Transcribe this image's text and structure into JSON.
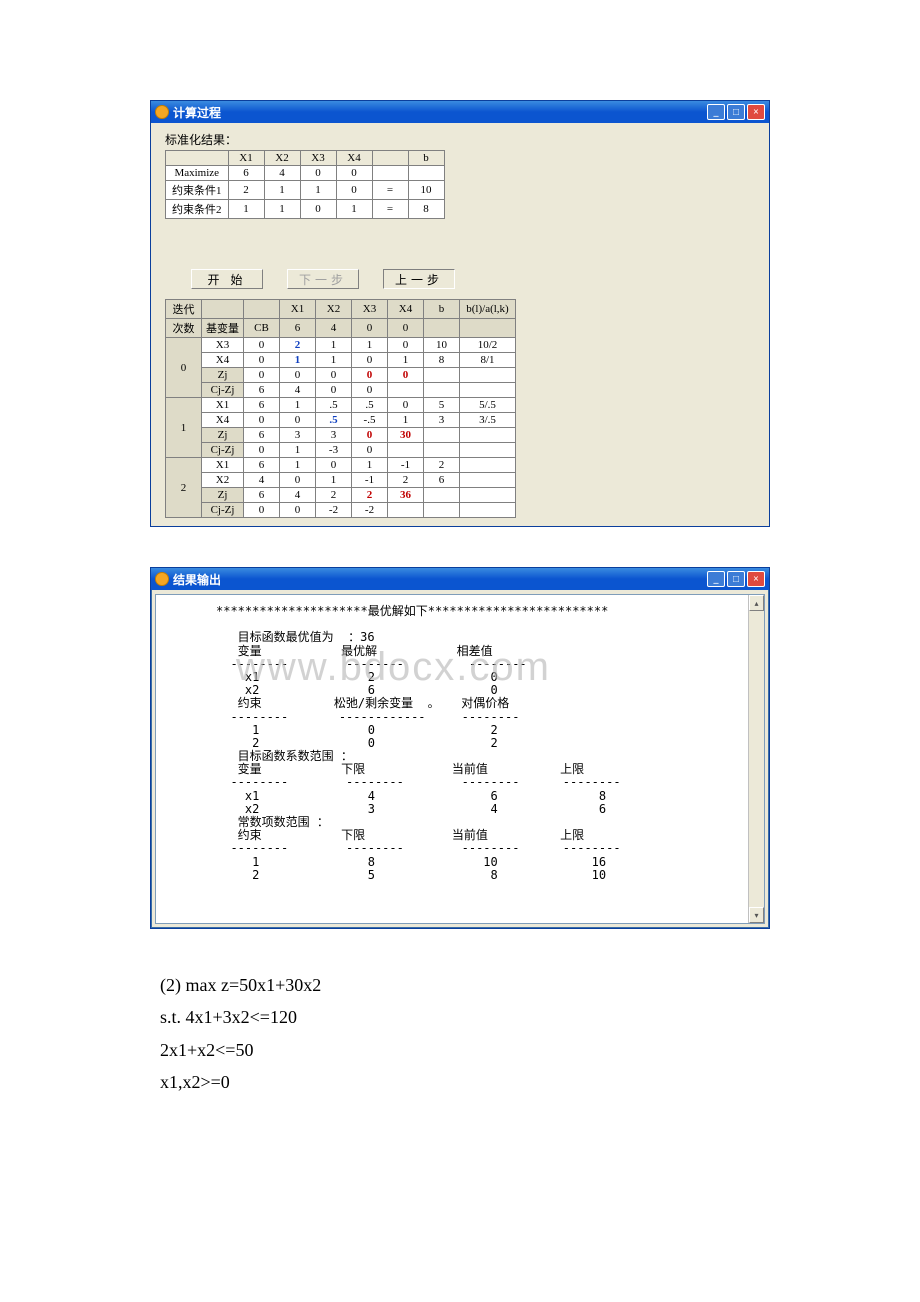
{
  "win1": {
    "title": "计算过程",
    "sectionLabel": "标准化结果：",
    "std": {
      "headers": [
        "",
        "X1",
        "X2",
        "X3",
        "X4",
        "",
        "b"
      ],
      "rows": [
        [
          "Maximize",
          "6",
          "4",
          "0",
          "0",
          "",
          ""
        ],
        [
          "约束条件1",
          "2",
          "1",
          "1",
          "0",
          "=",
          "10"
        ],
        [
          "约束条件2",
          "1",
          "1",
          "0",
          "1",
          "=",
          "8"
        ]
      ]
    },
    "buttons": {
      "start": "开 始",
      "next": "下一步",
      "prev": "上一步"
    },
    "simplex": {
      "topHeaders": [
        "迭代",
        "",
        "",
        "X1",
        "X2",
        "X3",
        "X4",
        "b",
        "b(l)/a(l,k)"
      ],
      "subHeaders": [
        "次数",
        "基变量",
        "CB",
        "6",
        "4",
        "0",
        "0",
        "",
        ""
      ],
      "iters": [
        {
          "num": "0",
          "rows": [
            [
              "X3",
              "0",
              "2",
              "1",
              "1",
              "0",
              "10",
              "10/2"
            ],
            [
              "X4",
              "0",
              "1",
              "1",
              "0",
              "1",
              "8",
              "8/1"
            ],
            [
              "Zj",
              "0",
              "0",
              "0",
              "0",
              "_0_",
              ""
            ],
            [
              "Cj-Zj",
              "6",
              "4",
              "0",
              "0",
              "",
              ""
            ]
          ],
          "blueCells": [
            [
              0,
              2
            ],
            [
              1,
              2
            ]
          ],
          "redCells": [
            [
              2,
              4
            ]
          ]
        },
        {
          "num": "1",
          "rows": [
            [
              "X1",
              "6",
              "1",
              ".5",
              ".5",
              "0",
              "5",
              "5/.5"
            ],
            [
              "X4",
              "0",
              "0",
              ".5",
              "-.5",
              "1",
              "3",
              "3/.5"
            ],
            [
              "Zj",
              "6",
              "3",
              "3",
              "0",
              "_30_",
              ""
            ],
            [
              "Cj-Zj",
              "0",
              "1",
              "-3",
              "0",
              "",
              ""
            ]
          ],
          "blueCells": [
            [
              1,
              3
            ]
          ],
          "redCells": [
            [
              2,
              4
            ]
          ]
        },
        {
          "num": "2",
          "rows": [
            [
              "X1",
              "6",
              "1",
              "0",
              "1",
              "-1",
              "2",
              ""
            ],
            [
              "X2",
              "4",
              "0",
              "1",
              "-1",
              "2",
              "6",
              ""
            ],
            [
              "Zj",
              "6",
              "4",
              "2",
              "2",
              "_36_",
              ""
            ],
            [
              "Cj-Zj",
              "0",
              "0",
              "-2",
              "-2",
              "",
              ""
            ]
          ],
          "redCells": [
            [
              2,
              4
            ]
          ]
        }
      ]
    }
  },
  "win2": {
    "title": "结果输出",
    "watermark": "www.bdocx.com",
    "text": "*********************最优解如下*************************\n\n   目标函数最优值为  ：36\n   变量           最优解           相差值\n  --------        --------         --------\n    x1               2                0\n    x2               6                0\n   约束          松弛/剩余变量  。   对偶价格\n  --------       ------------     --------\n     1               0                2\n     2               0                2\n   目标函数系数范围 ：\n   变量           下限            当前值          上限\n  --------        --------        --------      --------\n    x1               4                6              8\n    x2               3                4              6\n   常数项数范围 ：\n   约束           下限            当前值          上限\n  --------        --------        --------      --------\n     1               8               10             16\n     2               5                8             10"
  },
  "problem": {
    "p1": "(2) max  z=50x1+30x2",
    "p2": "s.t. 4x1+3x2<=120",
    "p3": " 2x1+x2<=50",
    "p4": " x1,x2>=0"
  }
}
